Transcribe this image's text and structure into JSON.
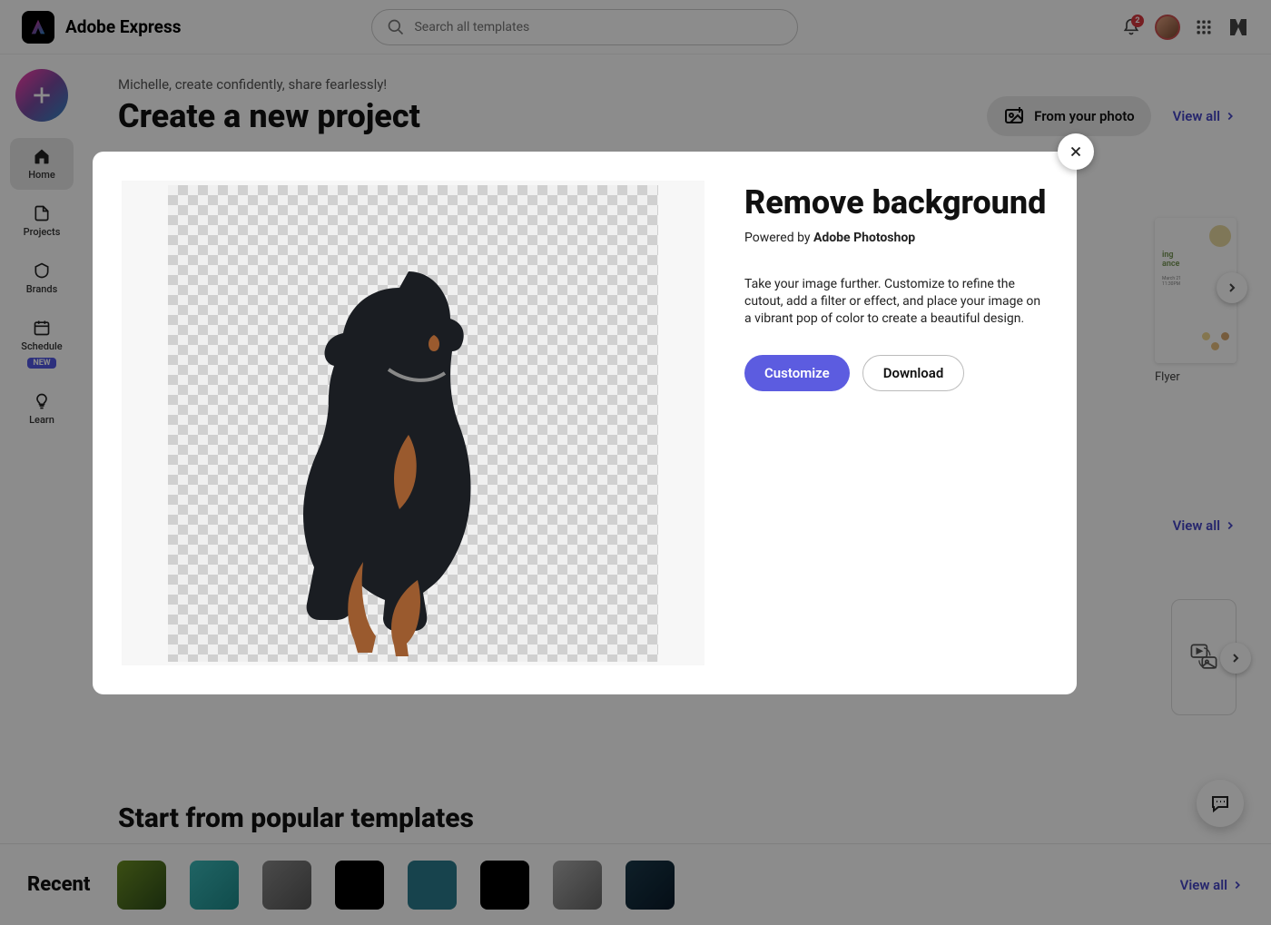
{
  "header": {
    "app_name": "Adobe Express",
    "search_placeholder": "Search all templates",
    "notification_count": "2"
  },
  "sidebar": {
    "items": [
      {
        "label": "Home",
        "icon": "home-icon"
      },
      {
        "label": "Projects",
        "icon": "file-icon"
      },
      {
        "label": "Brands",
        "icon": "brand-icon"
      },
      {
        "label": "Schedule",
        "icon": "calendar-icon",
        "badge": "NEW"
      },
      {
        "label": "Learn",
        "icon": "lightbulb-icon"
      }
    ]
  },
  "content": {
    "greeting": "Michelle, create confidently, share fearlessly!",
    "heading": "Create a new project",
    "from_photo_label": "From your photo",
    "view_all_label": "View all",
    "flyer_label": "Flyer",
    "templates_heading": "Start from popular templates"
  },
  "recent": {
    "label": "Recent",
    "view_all_label": "View all",
    "thumbnails": [
      {
        "bg": "linear-gradient(135deg,#6b8e23,#2e4d1a)"
      },
      {
        "bg": "linear-gradient(135deg,#3ab7b7,#1e8a8a)"
      },
      {
        "bg": "linear-gradient(135deg,#888,#555)"
      },
      {
        "bg": "#000"
      },
      {
        "bg": "#2b7a8c"
      },
      {
        "bg": "#000"
      },
      {
        "bg": "linear-gradient(135deg,#aaa,#666)"
      },
      {
        "bg": "linear-gradient(135deg,#1a3a4a,#0a1a2a)"
      }
    ]
  },
  "modal": {
    "title": "Remove background",
    "powered_prefix": "Powered by ",
    "powered_brand": "Adobe Photoshop",
    "description": "Take your image further. Customize to refine the cutout, add a filter or effect, and place your image on a vibrant pop of color to create a beautiful design.",
    "customize_label": "Customize",
    "download_label": "Download",
    "preview_subject": "doberman-dog"
  }
}
